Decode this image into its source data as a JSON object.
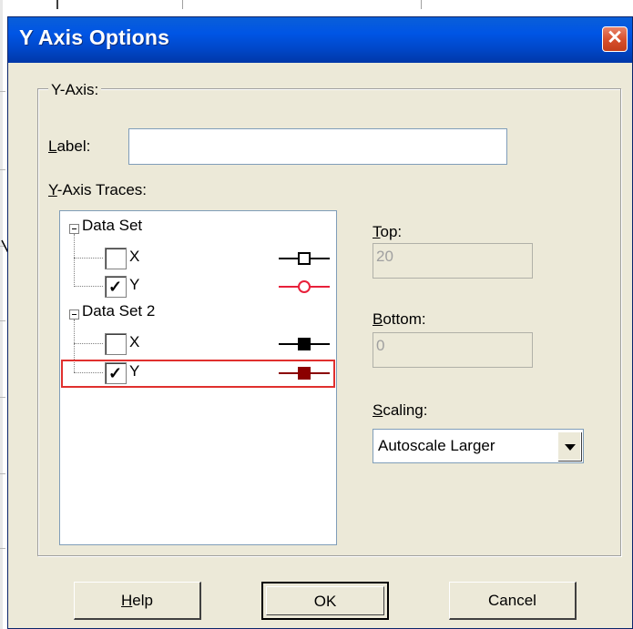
{
  "dialog": {
    "title": "Y Axis Options",
    "close_glyph": "✕"
  },
  "group": {
    "legend": "Y-Axis:"
  },
  "label_field": {
    "label_prefix": "",
    "label_mnemonic": "L",
    "label_rest": "abel:",
    "value": ""
  },
  "traces": {
    "heading_mnemonic": "Y",
    "heading_rest": "-Axis Traces:",
    "datasets": [
      {
        "name": "Data Set",
        "items": [
          {
            "label": "X",
            "checked": false,
            "marker": "open-square",
            "color": "#000000"
          },
          {
            "label": "Y",
            "checked": true,
            "marker": "open-circle",
            "color": "#e8203a"
          }
        ]
      },
      {
        "name": "Data Set 2",
        "items": [
          {
            "label": "X",
            "checked": false,
            "marker": "filled-square",
            "color": "#000000"
          },
          {
            "label": "Y",
            "checked": true,
            "marker": "filled-square",
            "color": "#8b0000",
            "selected": true
          }
        ]
      }
    ],
    "check_glyph": "✓"
  },
  "top_field": {
    "mnemonic": "T",
    "rest": "op:",
    "value": "20"
  },
  "bottom_field": {
    "mnemonic": "B",
    "rest": "ottom:",
    "value": "0"
  },
  "scaling": {
    "mnemonic": "S",
    "rest": "caling:",
    "selected": "Autoscale Larger"
  },
  "buttons": {
    "help_mnemonic": "H",
    "help_rest": "elp",
    "ok": "OK",
    "cancel": "Cancel"
  },
  "colors": {
    "title_bar": "#0055e5",
    "selection_outline": "#e0302e",
    "dialog_bg": "#ece9d8"
  }
}
